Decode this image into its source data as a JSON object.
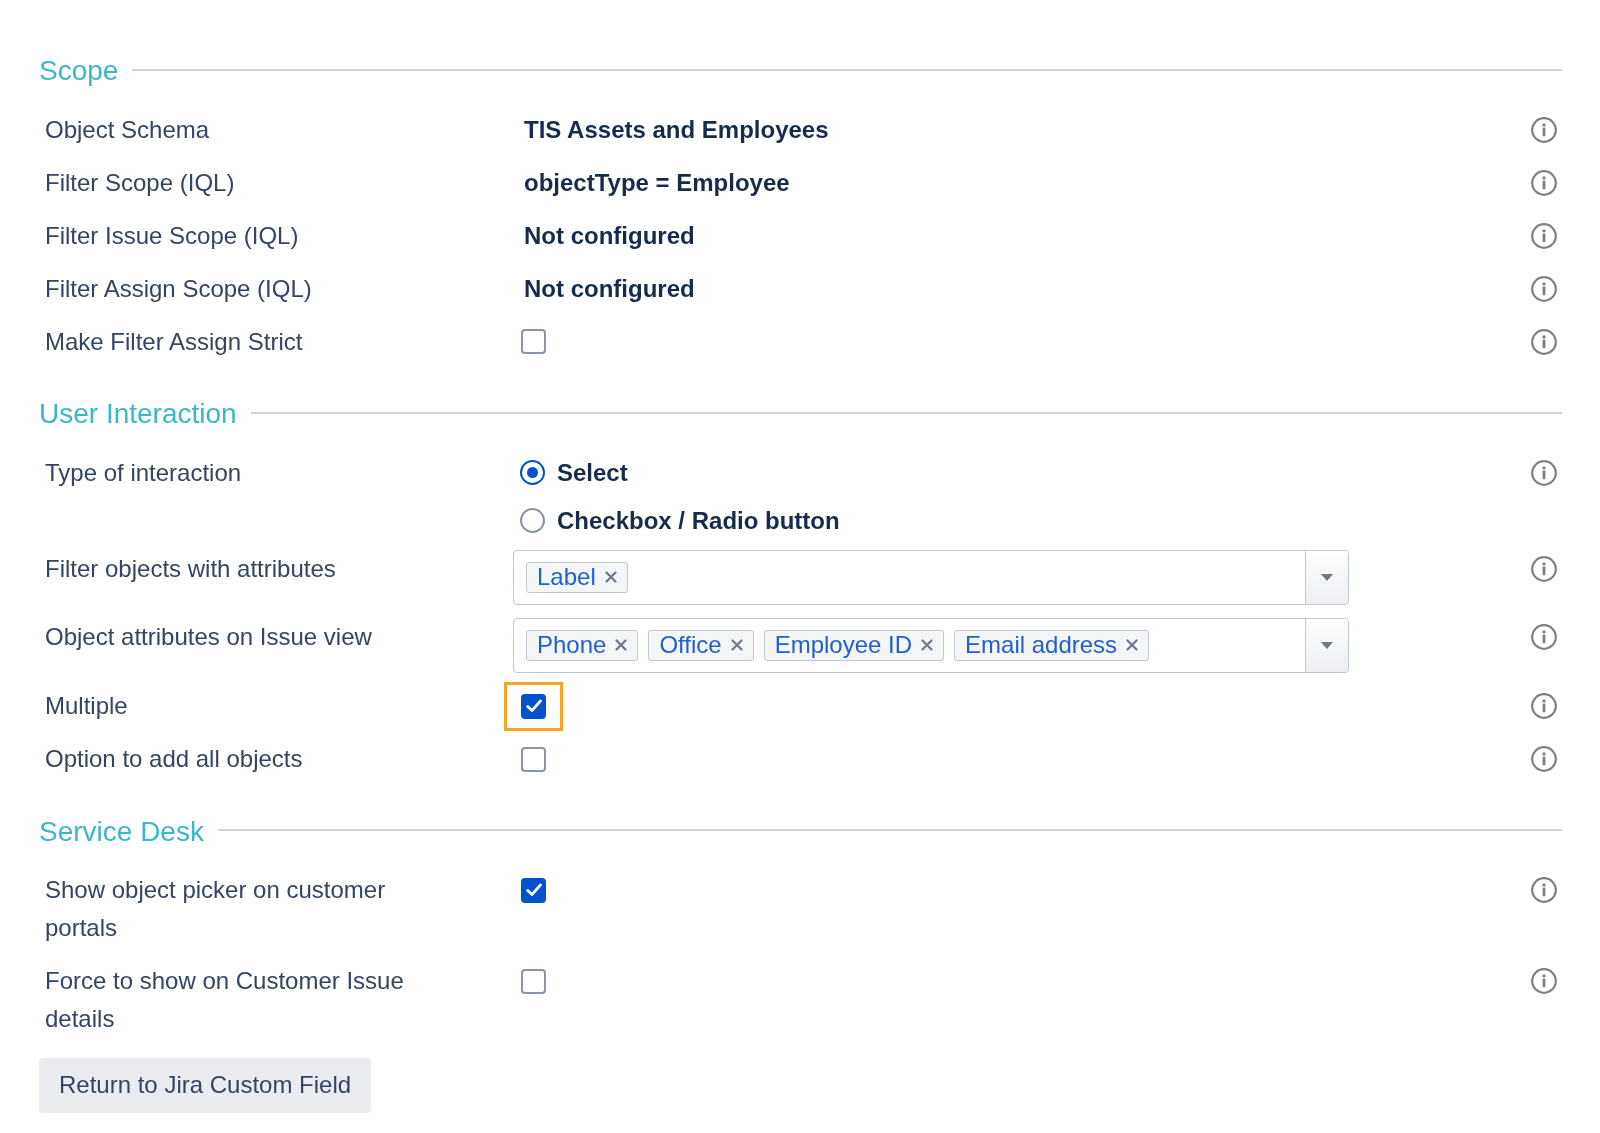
{
  "sections": [
    {
      "title": "Scope",
      "rows": [
        {
          "kind": "text",
          "label": "Object Schema",
          "value": "TIS Assets and Employees"
        },
        {
          "kind": "text",
          "label": "Filter Scope (IQL)",
          "value": "objectType = Employee"
        },
        {
          "kind": "text",
          "label": "Filter Issue Scope (IQL)",
          "value": "Not configured"
        },
        {
          "kind": "text",
          "label": "Filter Assign Scope (IQL)",
          "value": "Not configured"
        },
        {
          "kind": "checkbox",
          "label": "Make Filter Assign Strict",
          "checked": false,
          "focused": false
        }
      ]
    },
    {
      "title": "User Interaction",
      "rows": [
        {
          "kind": "radio",
          "label": "Type of interaction",
          "options": [
            {
              "label": "Select",
              "selected": true
            },
            {
              "label": "Checkbox / Radio button",
              "selected": false
            }
          ]
        },
        {
          "kind": "multiselect",
          "label": "Filter objects with attributes",
          "tags": [
            "Label"
          ]
        },
        {
          "kind": "multiselect",
          "label": "Object attributes on Issue view",
          "tags": [
            "Phone",
            "Office",
            "Employee ID",
            "Email address"
          ]
        },
        {
          "kind": "checkbox",
          "label": "Multiple",
          "checked": true,
          "focused": true
        },
        {
          "kind": "checkbox",
          "label": "Option to add all objects",
          "checked": false,
          "focused": false
        }
      ]
    },
    {
      "title": "Service Desk",
      "rows": [
        {
          "kind": "checkbox",
          "label": "Show object picker on customer portals",
          "checked": true,
          "focused": false
        },
        {
          "kind": "checkbox",
          "label": "Force to show on Customer Issue details",
          "checked": false,
          "focused": false
        }
      ]
    }
  ],
  "button": "Return to Jira Custom Field"
}
